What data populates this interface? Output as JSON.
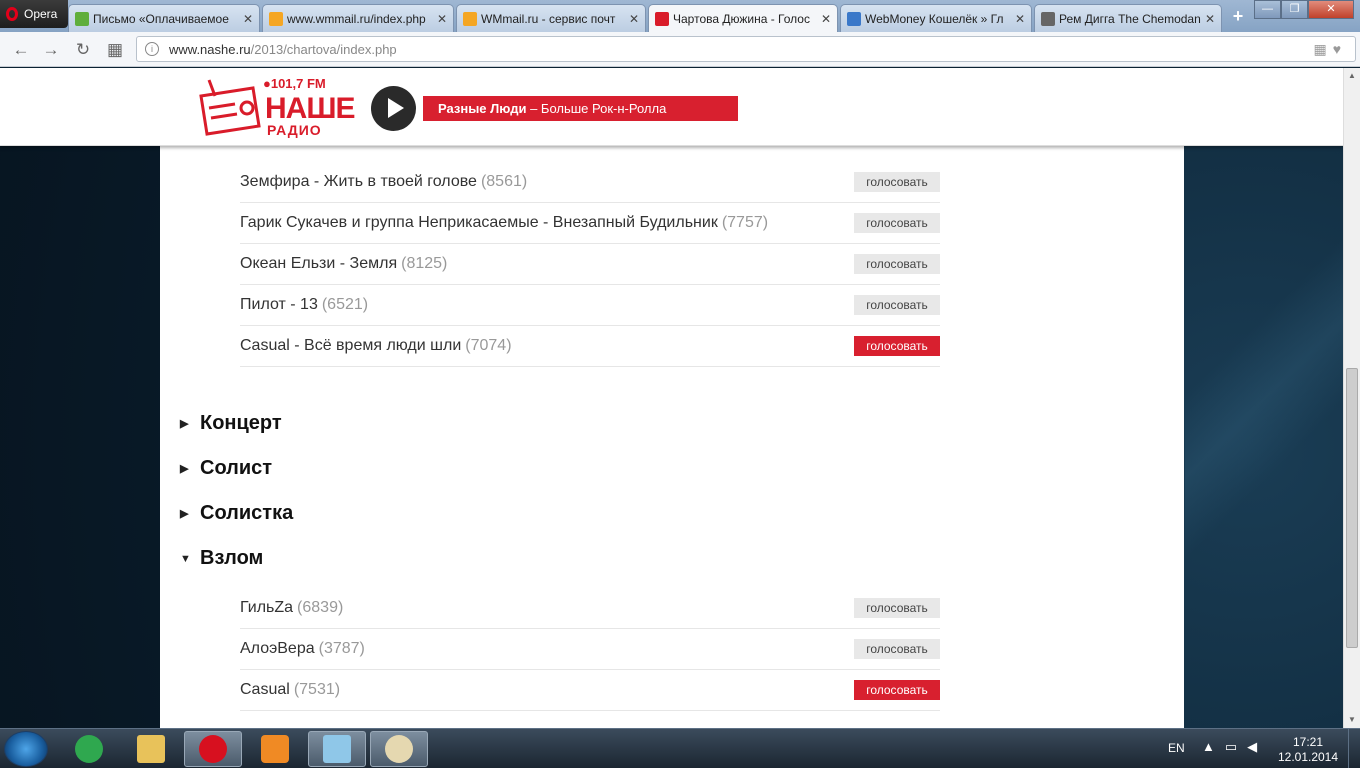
{
  "browser": {
    "menu_label": "Opera",
    "tabs": [
      {
        "label": "Письмо «Оплачиваемое",
        "favicon_color": "#5fae3b"
      },
      {
        "label": "www.wmmail.ru/index.php",
        "favicon_color": "#f5a623"
      },
      {
        "label": "WMmail.ru - сервис почт",
        "favicon_color": "#f5a623"
      },
      {
        "label": "Чартова Дюжина - Голос",
        "favicon_color": "#d91c2a"
      },
      {
        "label": "WebMoney Кошелёк » Гл",
        "favicon_color": "#3a78c9"
      },
      {
        "label": "Рем Дигга The Chemodan",
        "favicon_color": "#666666"
      }
    ],
    "active_tab_index": 3,
    "url_domain": "www.nashe.ru",
    "url_path": "/2013/chartova/index.php"
  },
  "header": {
    "frequency": "●101,7 FM",
    "station_name": "НАШЕ",
    "station_sub": "РАДИО",
    "now_playing_artist": "Разные Люди",
    "now_playing_track": " – Больше Рок-н-Ролла",
    "accent_color": "#d8202f"
  },
  "vote_label": "голосовать",
  "list_top": [
    {
      "title": "Земфира - Жить в твоей голове",
      "count": "(8561)",
      "selected": false
    },
    {
      "title": "Гарик Сукачев и группа Неприкасаемые - Внезапный Будильник",
      "count": "(7757)",
      "selected": false
    },
    {
      "title": "Океан Ельзи - Земля",
      "count": "(8125)",
      "selected": false
    },
    {
      "title": "Пилот - 13",
      "count": "(6521)",
      "selected": false
    },
    {
      "title": "Casual - Всё время люди шли",
      "count": "(7074)",
      "selected": true
    }
  ],
  "categories": [
    {
      "label": "Концерт",
      "expanded": false
    },
    {
      "label": "Солист",
      "expanded": false
    },
    {
      "label": "Солистка",
      "expanded": false
    },
    {
      "label": "Взлом",
      "expanded": true
    }
  ],
  "list_vzlom": [
    {
      "title": "ГильZa",
      "count": "(6839)",
      "selected": false
    },
    {
      "title": "АлоэВера",
      "count": "(3787)",
      "selected": false
    },
    {
      "title": "Casual",
      "count": "(7531)",
      "selected": true
    }
  ],
  "taskbar": {
    "language": "EN",
    "time": "17:21",
    "date": "12.01.2014"
  }
}
